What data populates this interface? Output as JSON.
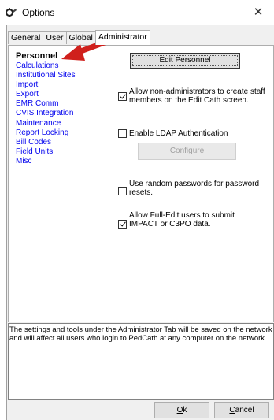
{
  "window": {
    "title": "Options",
    "close_glyph": "✕"
  },
  "tabs": [
    {
      "label": "General",
      "active": false
    },
    {
      "label": "User",
      "active": false
    },
    {
      "label": "Global",
      "active": false
    },
    {
      "label": "Administrator",
      "active": true
    }
  ],
  "sidebar": {
    "items": [
      {
        "label": "Personnel",
        "selected": true
      },
      {
        "label": "Calculations"
      },
      {
        "label": "Institutional Sites"
      },
      {
        "label": "Import"
      },
      {
        "label": "Export"
      },
      {
        "label": "EMR Comm"
      },
      {
        "label": "CVIS Integration"
      },
      {
        "label": "Maintenance"
      },
      {
        "label": "Report Locking"
      },
      {
        "label": "Bill Codes"
      },
      {
        "label": "Field Units"
      },
      {
        "label": "Misc"
      }
    ]
  },
  "personnel": {
    "edit_button": "Edit Personnel",
    "allow_non_admin": {
      "label_line1": "Allow non-administrators to create staff",
      "label_line2": "members on the Edit Cath screen.",
      "checked": true
    },
    "enable_ldap": {
      "label": "Enable LDAP Authentication",
      "checked": false
    },
    "configure_button": "Configure",
    "random_passwords": {
      "label_line1": "Use random passwords for password",
      "label_line2": "resets.",
      "checked": false
    },
    "allow_full_edit": {
      "label_line1": "Allow Full-Edit users to submit",
      "label_line2": "IMPACT or C3PO data.",
      "checked": true
    }
  },
  "info_text": "The settings and tools under the Administrator Tab will be saved on the network and will affect all users who login to PedCath at any computer on the network.",
  "footer": {
    "ok_accel": "O",
    "ok_rest": "k",
    "cancel_accel": "C",
    "cancel_rest": "ancel"
  },
  "colors": {
    "annotation_arrow": "#d0201c",
    "link": "#0000ee"
  }
}
